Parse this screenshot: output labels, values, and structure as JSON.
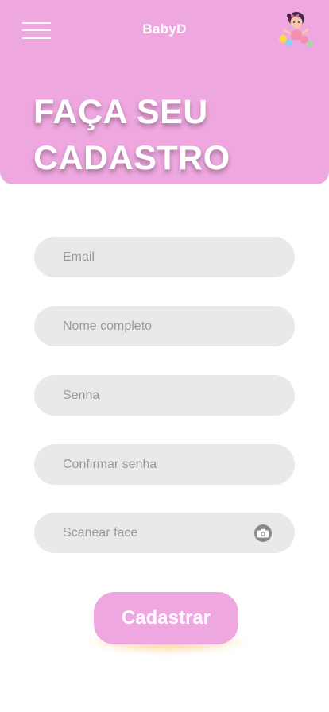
{
  "header": {
    "app_title": "BabyD",
    "page_title_line1": "FAÇA SEU",
    "page_title_line2": "CADASTRO"
  },
  "form": {
    "email_placeholder": "Email",
    "name_placeholder": "Nome completo",
    "password_placeholder": "Senha",
    "confirm_password_placeholder": "Confirmar senha",
    "face_scan_placeholder": "Scanear face",
    "submit_label": "Cadastrar"
  },
  "icons": {
    "menu": "hamburger-menu-icon",
    "mascot": "baby-mascot-icon",
    "camera": "camera-icon"
  },
  "colors": {
    "brand_pink": "#eea7df",
    "field_bg": "#e9e9e9",
    "placeholder": "#9a9a9a",
    "button_glow": "#f8c478"
  }
}
